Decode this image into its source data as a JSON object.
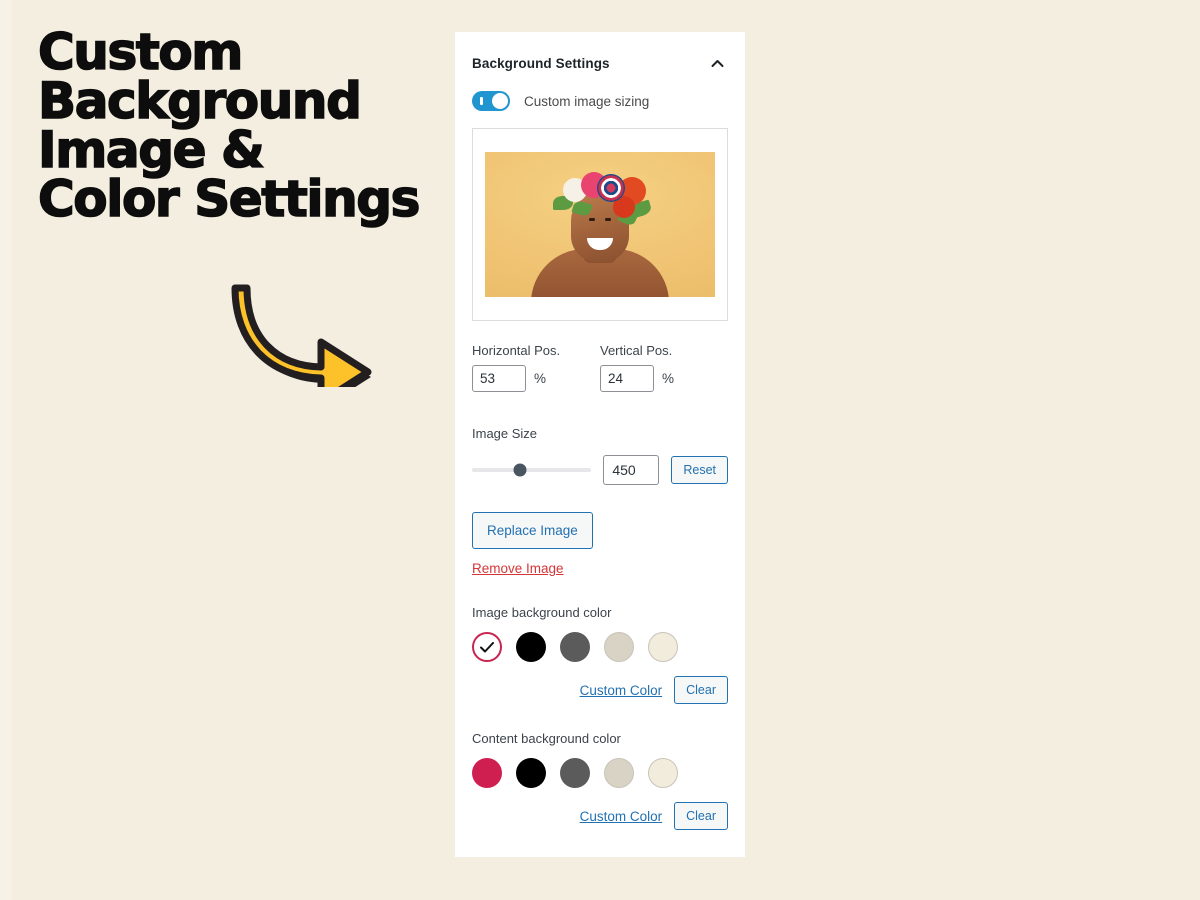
{
  "promo": {
    "heading_lines": [
      "Custom",
      "Background",
      "Image &",
      "Color Settings"
    ],
    "arrow_icon": "curved-arrow-right-icon",
    "arrow_fill": "#FDC12A",
    "arrow_outline": "#231F20"
  },
  "page": {
    "background_color": "#f4eee0"
  },
  "panel": {
    "title": "Background Settings",
    "collapse_icon": "chevron-up-icon",
    "toggle": {
      "label": "Custom image sizing",
      "state": "on",
      "on_color": "#2095d0"
    },
    "image_preview": {
      "alt": "smiling woman wearing floral crown on yellow background",
      "background_color": "#f1c878"
    },
    "horizontal_pos": {
      "label": "Horizontal Pos.",
      "value": "53",
      "unit": "%"
    },
    "vertical_pos": {
      "label": "Vertical Pos.",
      "value": "24",
      "unit": "%"
    },
    "image_size": {
      "label": "Image Size",
      "value": "450",
      "slider_percent": 40,
      "reset_label": "Reset"
    },
    "replace_button": "Replace Image",
    "remove_link": "Remove Image",
    "image_background_color": {
      "label": "Image background color",
      "custom_color_label": "Custom Color",
      "clear_label": "Clear",
      "swatches": [
        {
          "name": "swatch-selected-white",
          "color": "#ffffff",
          "selected": true,
          "ring_color": "#c8254f"
        },
        {
          "name": "swatch-black",
          "color": "#000000",
          "selected": false
        },
        {
          "name": "swatch-gray",
          "color": "#5b5b5b",
          "selected": false
        },
        {
          "name": "swatch-taupe",
          "color": "#d9d3c6",
          "selected": false
        },
        {
          "name": "swatch-cream",
          "color": "#f2ecdd",
          "selected": false
        }
      ]
    },
    "content_background_color": {
      "label": "Content background color",
      "custom_color_label": "Custom Color",
      "clear_label": "Clear",
      "swatches": [
        {
          "name": "swatch-crimson",
          "color": "#ce1f50",
          "selected": false
        },
        {
          "name": "swatch-black",
          "color": "#000000",
          "selected": false
        },
        {
          "name": "swatch-gray",
          "color": "#5b5b5b",
          "selected": false
        },
        {
          "name": "swatch-taupe",
          "color": "#d9d3c6",
          "selected": false
        },
        {
          "name": "swatch-cream",
          "color": "#f2ecdd",
          "selected": false
        }
      ]
    }
  }
}
